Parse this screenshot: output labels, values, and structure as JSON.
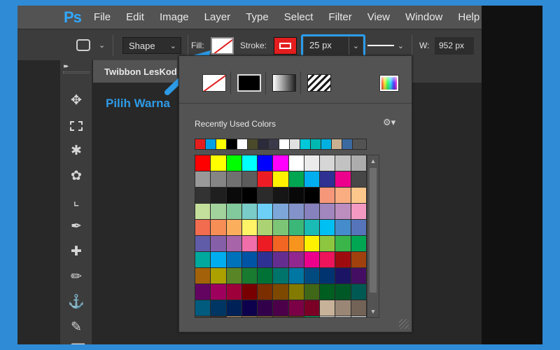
{
  "app": {
    "logo": "Ps"
  },
  "menu": [
    "File",
    "Edit",
    "Image",
    "Layer",
    "Type",
    "Select",
    "Filter",
    "View",
    "Window",
    "Help"
  ],
  "options_bar": {
    "mode": "Shape",
    "fill_label": "Fill:",
    "stroke_label": "Stroke:",
    "stroke_width": "25 px",
    "w_label": "W:",
    "w_value": "952 px"
  },
  "document": {
    "tab_title": "Twibbon LesKoding"
  },
  "annotation": {
    "text": "Pilih Warna",
    "color": "#2e9be6"
  },
  "fill_panel": {
    "recent_label": "Recently Used Colors",
    "recent_colors": [
      "#e41e1e",
      "#00a0e9",
      "#ffff00",
      "#000000",
      "#ffffff",
      "#4a4a2a",
      "#2b2b3b",
      "#3a3a4a",
      "#ffffff",
      "#e0e0e0",
      "#00c8d8",
      "#00b8b0",
      "#00b0e0",
      "#c8b090",
      "#3a6aa0"
    ],
    "swatch_rows": [
      [
        "#ff0000",
        "#ffff00",
        "#00ff00",
        "#00ffff",
        "#0000ff",
        "#ff00ff",
        "#ffffff",
        "#ebebeb",
        "#d6d6d6",
        "#c2c2c2",
        "#adadad"
      ],
      [
        "#999999",
        "#858585",
        "#707070",
        "#5c5c5c",
        "#ed1c24",
        "#fff200",
        "#00a651",
        "#00aeef",
        "#2e3192",
        "#ec008c",
        "#474747"
      ],
      [
        "#333333",
        "#1f1f1f",
        "#0a0a0a",
        "#000000",
        "#2b2b2b",
        "#161616",
        "#080808",
        "#000000",
        "#f7977a",
        "#f9ad81",
        "#fdc68a"
      ],
      [
        "#c4df9b",
        "#a3d39c",
        "#82ca9c",
        "#7accc8",
        "#6dcff6",
        "#7da7d9",
        "#8393ca",
        "#8781bd",
        "#a187be",
        "#bc8dbf",
        "#f49ac2"
      ],
      [
        "#f26c4f",
        "#f68e56",
        "#fbaf5d",
        "#fff467",
        "#acd373",
        "#7cc576",
        "#3bb878",
        "#1abbb4",
        "#00bff3",
        "#448ccb",
        "#5674b9"
      ],
      [
        "#605ca8",
        "#855fa8",
        "#a864a8",
        "#f06eaa",
        "#ed1c24",
        "#f26522",
        "#f7941d",
        "#fff200",
        "#8dc73f",
        "#39b54a",
        "#00a651"
      ],
      [
        "#00a99d",
        "#00aeef",
        "#0072bc",
        "#0054a6",
        "#2e3192",
        "#662d91",
        "#92278f",
        "#ec008c",
        "#ed145b",
        "#9e0b0f",
        "#a0410d"
      ],
      [
        "#a36209",
        "#aba000",
        "#598527",
        "#197b30",
        "#007236",
        "#00746b",
        "#0076a3",
        "#004a80",
        "#003471",
        "#1b1464",
        "#440e62"
      ],
      [
        "#630460",
        "#9e005d",
        "#9e0039",
        "#790000",
        "#7b2e00",
        "#7d4900",
        "#827b00",
        "#406618",
        "#005e20",
        "#005826",
        "#005952"
      ],
      [
        "#005b7f",
        "#003663",
        "#002157",
        "#0d004c",
        "#32004b",
        "#4b0049",
        "#7b0046",
        "#7a0026",
        "#c7b299",
        "#998675",
        "#736357"
      ],
      [
        "#534741",
        "#37302d",
        "#c69c6d",
        "#a67c52",
        "#8c6239",
        "#754c24",
        "#603913",
        "#00a651",
        "#ffffff",
        "#ffffff",
        "#ffffff"
      ]
    ]
  },
  "icons": {
    "move": "move-tool-icon",
    "marquee": "marquee-tool-icon",
    "lasso": "lasso-tool-icon",
    "quick_select": "quick-selection-tool-icon",
    "crop": "crop-tool-icon",
    "eyedropper": "eyedropper-tool-icon",
    "healing": "healing-brush-tool-icon",
    "brush": "brush-tool-icon",
    "stamp": "clone-stamp-tool-icon",
    "history_brush": "history-brush-tool-icon",
    "eraser": "eraser-tool-icon"
  },
  "colors": {
    "page_background": "#2f8bd6",
    "highlight": "#2b9bea",
    "stroke_color": "#e41e1e"
  }
}
